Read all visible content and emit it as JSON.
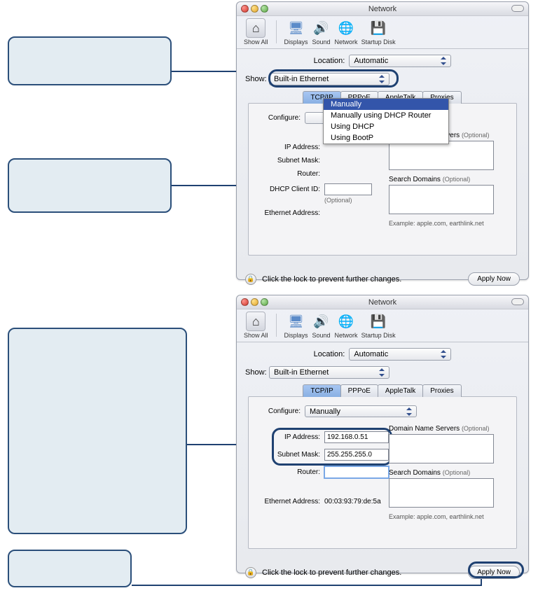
{
  "window_title": "Network",
  "toolbar": {
    "show_all": "Show All",
    "displays": "Displays",
    "sound": "Sound",
    "network": "Network",
    "startup_disk": "Startup Disk"
  },
  "location_label": "Location:",
  "location_value": "Automatic",
  "show_label": "Show:",
  "show_value": "Built-in Ethernet",
  "tabs": {
    "tcpip": "TCP/IP",
    "pppoe": "PPPoE",
    "appletalk": "AppleTalk",
    "proxies": "Proxies"
  },
  "configure_label": "Configure:",
  "configure_menu": {
    "manually": "Manually",
    "manually_dhcp": "Manually using DHCP Router",
    "using_dhcp": "Using DHCP",
    "using_bootp": "Using BootP"
  },
  "fields": {
    "ip_label": "IP Address:",
    "subnet_label": "Subnet Mask:",
    "router_label": "Router:",
    "dhcp_client_label": "DHCP Client ID:",
    "optional": "(Optional)",
    "ethernet_label": "Ethernet Address:",
    "dns_label": "Domain Name Servers",
    "search_label": "Search Domains",
    "example": "Example: apple.com, earthlink.net",
    "ip_value": "192.168.0.51",
    "subnet_value": "255.255.255.0",
    "ethernet_value": "00:03:93:79:de:5a",
    "configure_value": "Manually"
  },
  "footer": {
    "lock_text": "Click the lock to prevent further changes.",
    "apply": "Apply Now"
  }
}
